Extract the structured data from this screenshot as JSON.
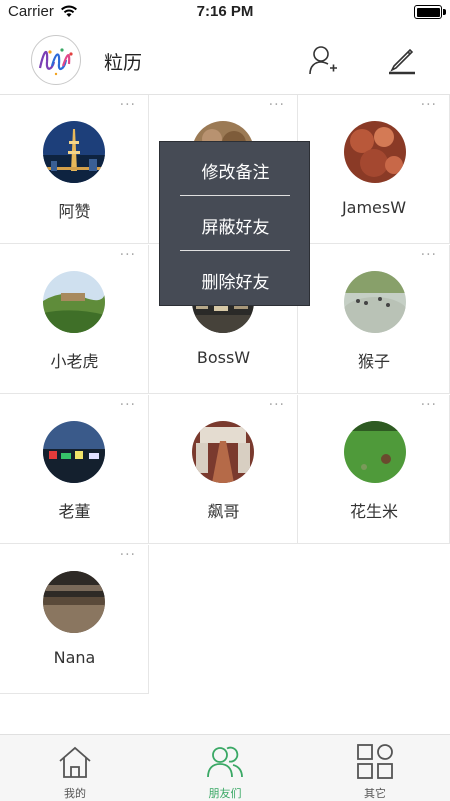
{
  "status_bar": {
    "carrier": "Carrier",
    "time": "7:16 PM"
  },
  "header": {
    "title": "粒历",
    "logo_text": "lili"
  },
  "friends": [
    {
      "name": "阿赞",
      "more": "···"
    },
    {
      "name": "",
      "more": "···"
    },
    {
      "name": "JamesW",
      "more": "···"
    },
    {
      "name": "小老虎",
      "more": "···"
    },
    {
      "name": "BossW",
      "more": "···"
    },
    {
      "name": "猴子",
      "more": "···"
    },
    {
      "name": "老董",
      "more": "···"
    },
    {
      "name": "飙哥",
      "more": "···"
    },
    {
      "name": "花生米",
      "more": "···"
    },
    {
      "name": "Nana",
      "more": "···"
    }
  ],
  "context_menu": {
    "items": [
      "修改备注",
      "屏蔽好友",
      "删除好友"
    ]
  },
  "tabs": [
    {
      "label": "我的",
      "icon": "home-icon"
    },
    {
      "label": "朋友们",
      "icon": "friends-icon"
    },
    {
      "label": "其它",
      "icon": "apps-icon"
    }
  ],
  "colors": {
    "accent": "#3aa865",
    "menu_bg": "#464b55"
  }
}
